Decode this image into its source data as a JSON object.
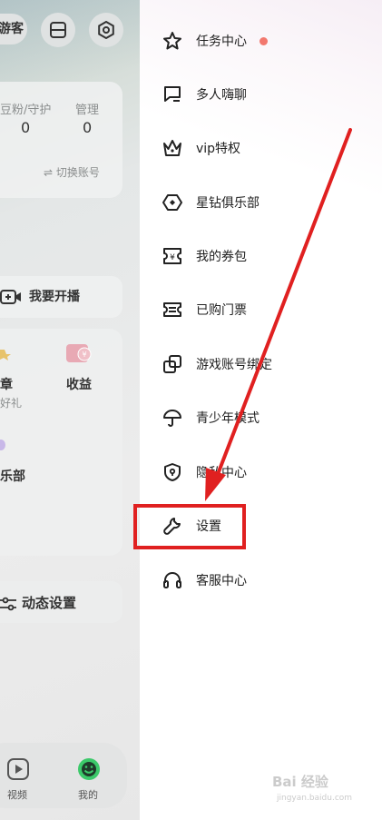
{
  "left_panel": {
    "visitor_label": "游客",
    "stats": [
      {
        "label": "豆粉/守护",
        "value": "0"
      },
      {
        "label": "管理",
        "value": "0"
      }
    ],
    "switch_account": "⇌ 切换账号",
    "go_live": "我要开播",
    "grid": {
      "item1_title": "章",
      "item1_sub": "好礼",
      "income": "收益",
      "club": "乐部"
    },
    "dynamic_settings": "动态设置",
    "tabs": [
      {
        "label": "视频"
      },
      {
        "label": "我的"
      }
    ]
  },
  "drawer": {
    "items": [
      {
        "label": "任务中心",
        "icon": "star-badge-icon"
      },
      {
        "label": "多人嗨聊",
        "icon": "chat-icon"
      },
      {
        "label": "vip特权",
        "icon": "crown-icon"
      },
      {
        "label": "星钻俱乐部",
        "icon": "diamond-icon"
      },
      {
        "label": "我的券包",
        "icon": "coupon-icon"
      },
      {
        "label": "已购门票",
        "icon": "ticket-icon"
      },
      {
        "label": "游戏账号绑定",
        "icon": "link-icon"
      },
      {
        "label": "青少年模式",
        "icon": "umbrella-icon"
      },
      {
        "label": "隐私中心",
        "icon": "shield-icon"
      },
      {
        "label": "设置",
        "icon": "wrench-icon"
      },
      {
        "label": "客服中心",
        "icon": "headset-icon"
      }
    ],
    "task_center_dot_color": "#f2786e"
  },
  "annotation": {
    "color": "#e02020"
  },
  "watermark": {
    "text": "Bai 经验",
    "sub": "jingyan.baidu.com"
  }
}
